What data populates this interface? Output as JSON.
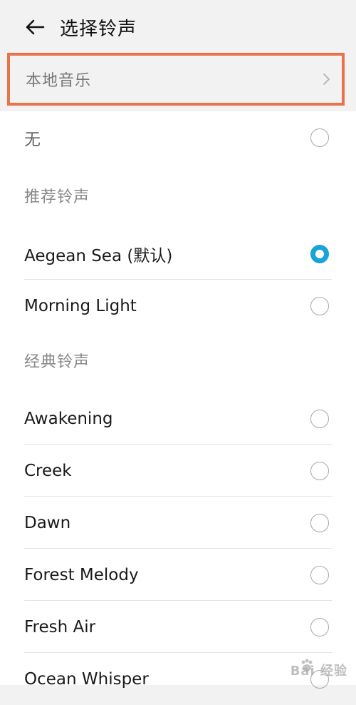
{
  "header": {
    "title": "选择铃声",
    "back_icon": "arrow-left-icon"
  },
  "local_music": {
    "label": "本地音乐",
    "icon": "chevron-right-icon",
    "highlight_color": "#e8724a"
  },
  "none_option": {
    "label": "无",
    "selected": false
  },
  "recommended": {
    "title": "推荐铃声",
    "items": [
      {
        "label": "Aegean Sea (默认)",
        "selected": true
      },
      {
        "label": "Morning Light",
        "selected": false
      }
    ]
  },
  "classic": {
    "title": "经典铃声",
    "items": [
      {
        "label": "Awakening",
        "selected": false
      },
      {
        "label": "Creek",
        "selected": false
      },
      {
        "label": "Dawn",
        "selected": false
      },
      {
        "label": "Forest Melody",
        "selected": false
      },
      {
        "label": "Fresh Air",
        "selected": false
      },
      {
        "label": "Ocean Whisper",
        "selected": false
      }
    ]
  },
  "colors": {
    "accent": "#1aa3d9",
    "background": "#f2f2f2",
    "card": "#ffffff"
  },
  "watermark": {
    "text": "Bai 经验",
    "icon": "paw-logo-icon"
  }
}
